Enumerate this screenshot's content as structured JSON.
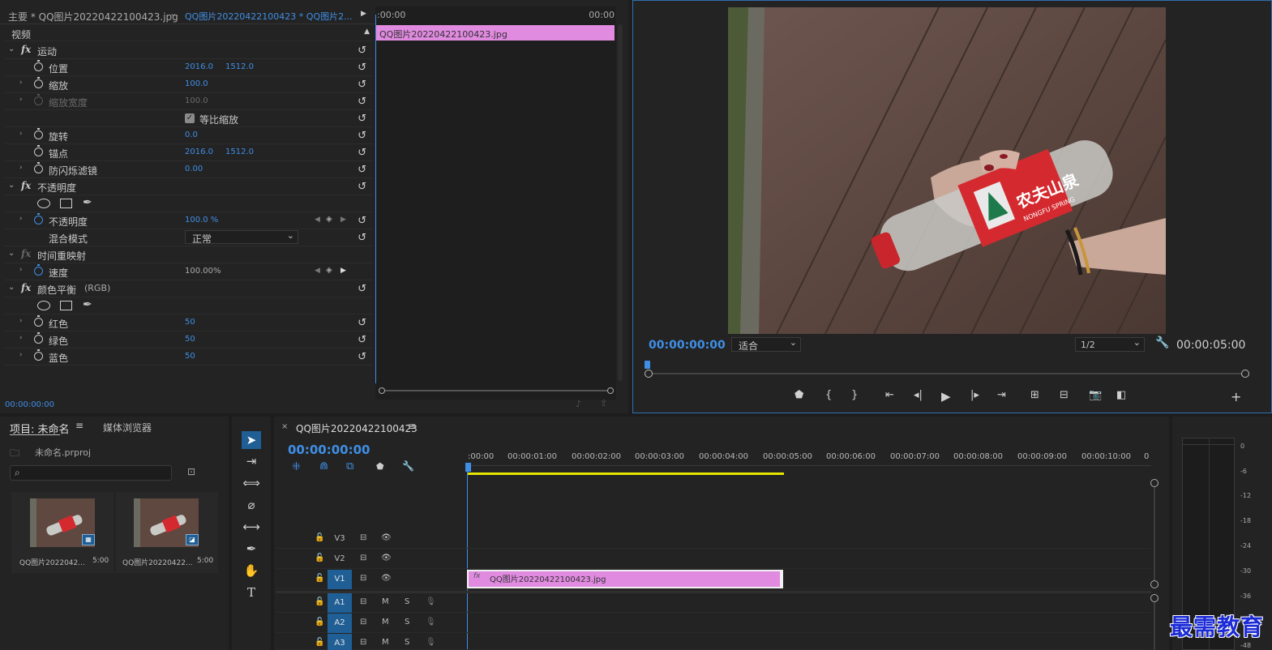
{
  "effect_controls": {
    "tab_main": "主要 * QQ图片20220422100423.jpg",
    "tab_seq": "QQ图片20220422100423 * QQ图片2...",
    "section_video": "视频",
    "motion": {
      "name": "运动",
      "position": {
        "label": "位置",
        "x": "2016.0",
        "y": "1512.0"
      },
      "scale": {
        "label": "缩放",
        "value": "100.0"
      },
      "scale_width": {
        "label": "缩放宽度",
        "value": "100.0"
      },
      "uniform": {
        "label": "等比缩放",
        "checked": true
      },
      "rotation": {
        "label": "旋转",
        "value": "0.0"
      },
      "anchor": {
        "label": "锚点",
        "x": "2016.0",
        "y": "1512.0"
      },
      "antiflicker": {
        "label": "防闪烁滤镜",
        "value": "0.00"
      }
    },
    "opacity": {
      "name": "不透明度",
      "value_label": "不透明度",
      "value": "100.0 %",
      "blend_label": "混合模式",
      "blend_value": "正常"
    },
    "time_remap": {
      "name": "时间重映射",
      "speed_label": "速度",
      "speed_value": "100.00%"
    },
    "color_balance": {
      "name": "颜色平衡",
      "suffix": "(RGB)",
      "red": {
        "label": "红色",
        "value": "50"
      },
      "green": {
        "label": "绿色",
        "value": "50"
      },
      "blue": {
        "label": "蓝色",
        "value": "50"
      }
    },
    "bottom_time": "00:00:00:00",
    "mini_timeline": {
      "start": ":00:00",
      "end": "00:00",
      "clip": "QQ图片20220422100423.jpg"
    }
  },
  "program_monitor": {
    "timecode": "00:00:00:00",
    "fit": "适合",
    "resolution": "1/2",
    "duration": "00:00:05:00",
    "bottle_text": "农夫山泉",
    "bottle_sub": "NONGFU SPRING"
  },
  "project": {
    "tab_project": "项目: 未命名",
    "tab_browser": "媒体浏览器",
    "file": "未命名.prproj",
    "items": [
      {
        "name": "QQ图片2022042...",
        "dur": "5:00"
      },
      {
        "name": "QQ图片20220422...",
        "dur": "5:00"
      }
    ]
  },
  "timeline": {
    "tab_name": "QQ图片20220422100423",
    "timecode": "00:00:00:00",
    "ruler": [
      ":00:00",
      "00:00:01:00",
      "00:00:02:00",
      "00:00:03:00",
      "00:00:04:00",
      "00:00:05:00",
      "00:00:06:00",
      "00:00:07:00",
      "00:00:08:00",
      "00:00:09:00",
      "00:00:10:00",
      "0"
    ],
    "tracks": [
      {
        "name": "V3",
        "type": "video"
      },
      {
        "name": "V2",
        "type": "video"
      },
      {
        "name": "V1",
        "type": "video"
      },
      {
        "name": "A1",
        "type": "audio"
      },
      {
        "name": "A2",
        "type": "audio"
      },
      {
        "name": "A3",
        "type": "audio"
      }
    ],
    "clip_name": "QQ图片20220422100423.jpg",
    "audio_m": "M",
    "audio_s": "S"
  },
  "meter_scale": [
    "0",
    "-6",
    "-12",
    "-18",
    "-24",
    "-30",
    "-36",
    "-42",
    "-48"
  ],
  "watermark": "最需教育",
  "colors": {
    "accent": "#3f8fe6",
    "clip": "#e08ae0",
    "workarea": "#e5e500",
    "track_select": "#1f5f95"
  }
}
